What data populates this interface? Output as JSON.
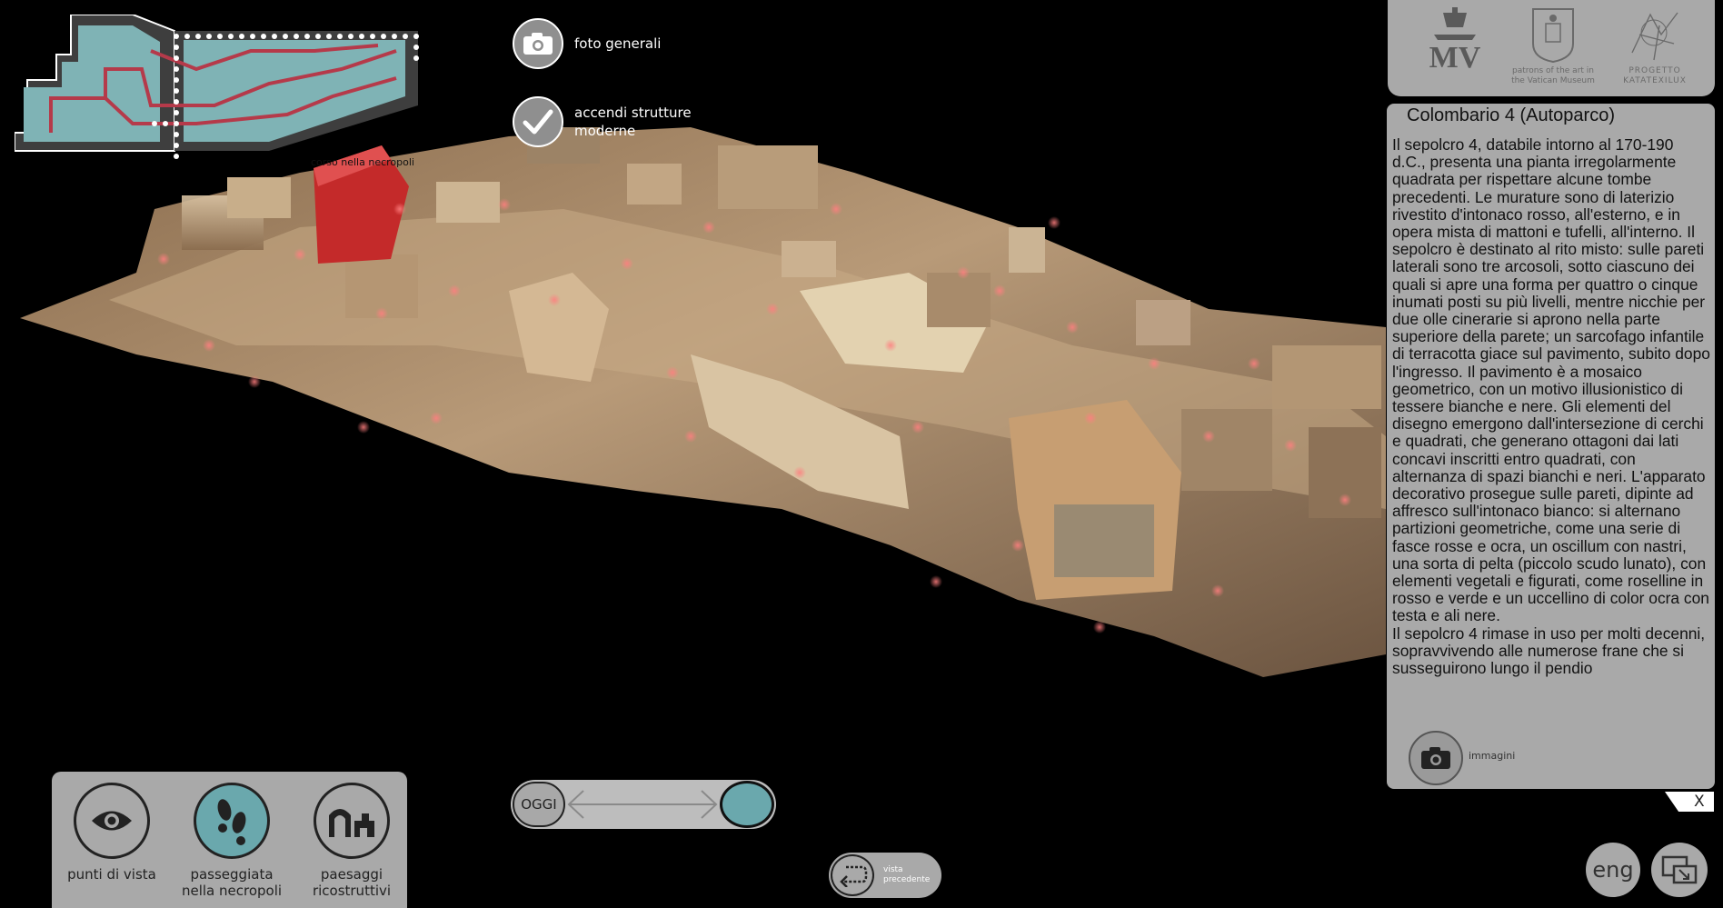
{
  "actions": {
    "foto_generali": "foto generali",
    "accendi_line1": "accendi strutture",
    "accendi_line2": "moderne"
  },
  "minimap": {
    "caption": "corso nella necropoli"
  },
  "logos": {
    "mv": "MV",
    "patrons": "patrons of the art in the Vatican Museum",
    "progetto": "PROGETTO KATATEXILUX"
  },
  "info": {
    "title": "Colombario 4 (Autoparco)",
    "paragraph1": "Il sepolcro 4, databile intorno al 170-190 d.C., presenta una pianta irregolarmente quadrata per rispettare alcune tombe precedenti. Le murature sono di laterizio rivestito d'intonaco rosso, all'esterno, e in opera mista di mattoni e tufelli, all'interno. Il sepolcro è destinato al rito misto: sulle pareti laterali sono tre arcosoli, sotto ciascuno dei quali si apre una forma per quattro o cinque inumati posti su più livelli, mentre nicchie per due olle cinerarie si aprono nella parte superiore della parete; un sarcofago infantile di terracotta giace sul pavimento, subito dopo l'ingresso. Il pavimento è a mosaico geometrico, con un motivo illusionistico di tessere bianche e nere. Gli elementi del disegno emergono dall'intersezione di cerchi e quadrati, che generano ottagoni dai lati concavi inscritti entro quadrati, con alternanza di spazi bianchi e neri. L'apparato decorativo prosegue sulle pareti, dipinte ad affresco sull'intonaco bianco: si alternano partizioni geometriche, come una serie di fasce rosse e ocra, un oscillum con nastri, una sorta di pelta (piccolo scudo lunato), con elementi vegetali e figurati, come roselline in rosso e verde e un uccellino di color ocra con testa e ali nere.",
    "paragraph2": "Il sepolcro 4 rimase in uso per molti decenni, sopravvivendo alle numerose frane che si susseguirono lungo il pendio",
    "images_label": "immagini",
    "close": "X"
  },
  "nav": {
    "punti": "punti di vista",
    "passeggiata_1": "passeggiata",
    "passeggiata_2": "nella necropoli",
    "paesaggi_1": "paesaggi",
    "paesaggi_2": "ricostruttivi"
  },
  "timeline": {
    "oggi": "OGGI"
  },
  "vista": {
    "line1": "vista",
    "line2": "precedente"
  },
  "lang": "eng",
  "colors": {
    "panel": "#a9a9a9",
    "accent": "#6aa8ad",
    "map_fill": "#7fb3b5",
    "map_path": "#b53a4a",
    "red_structure": "#c42a2a"
  }
}
